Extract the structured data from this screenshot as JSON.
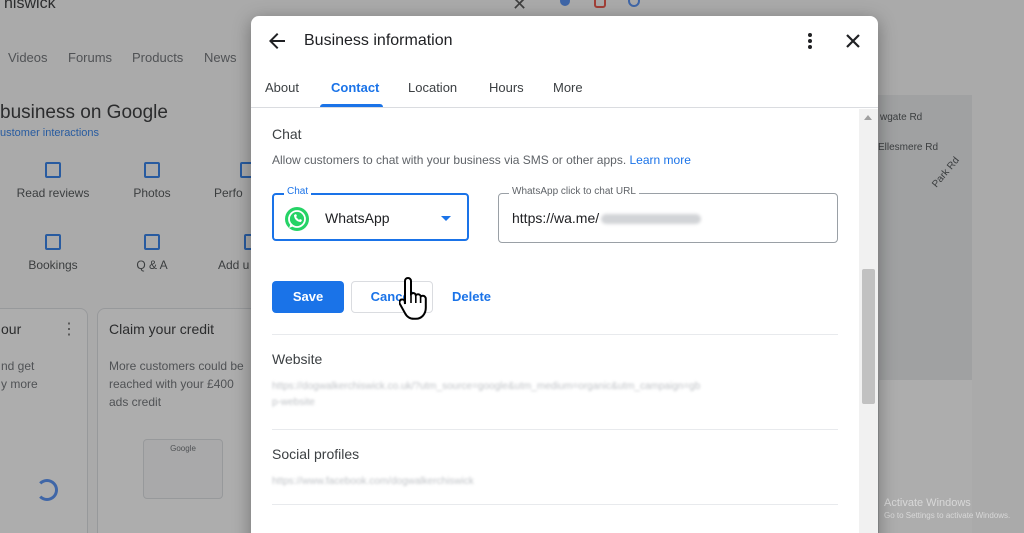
{
  "background": {
    "search_query": "hiswick",
    "tabs": [
      "Videos",
      "Forums",
      "Products",
      "News"
    ],
    "title": "business on Google",
    "subtitle": "ustomer interactions",
    "actions": [
      "Read reviews",
      "Photos",
      "Perfo",
      "Bookings",
      "Q & A",
      "Add u"
    ],
    "card1_title": "our",
    "card1_body": [
      "nd get",
      "y more"
    ],
    "card2_title": "Claim your credit",
    "card2_body": [
      "More customers could be",
      "reached with your £400",
      "ads credit"
    ],
    "card2_logo": "Google",
    "map_roads": [
      "wgate Rd",
      "Ellesmere Rd",
      "Park Rd"
    ],
    "activate_title": "Activate Windows",
    "activate_sub": "Go to Settings to activate Windows."
  },
  "dialog": {
    "title": "Business information",
    "tabs": [
      {
        "label": "About"
      },
      {
        "label": "Contact"
      },
      {
        "label": "Location"
      },
      {
        "label": "Hours"
      },
      {
        "label": "More"
      }
    ],
    "active_tab": "Contact",
    "chat": {
      "title": "Chat",
      "description": "Allow customers to chat with your business via SMS or other apps.",
      "learn_more": "Learn more",
      "select_label": "Chat",
      "select_value": "WhatsApp",
      "url_label": "WhatsApp click to chat URL",
      "url_value": "https://wa.me/"
    },
    "buttons": {
      "save": "Save",
      "cancel": "Cancel",
      "delete": "Delete"
    },
    "website": {
      "title": "Website",
      "value_line1": "https://dogwalkerchiswick.co.uk/?utm_source=google&utm_medium=organic&utm_campaign=gb",
      "value_line2": "p-website"
    },
    "social": {
      "title": "Social profiles",
      "value": "https://www.facebook.com/dogwalkerchiswick"
    }
  },
  "colors": {
    "accent": "#1a73e8",
    "whatsapp": "#25d366"
  }
}
